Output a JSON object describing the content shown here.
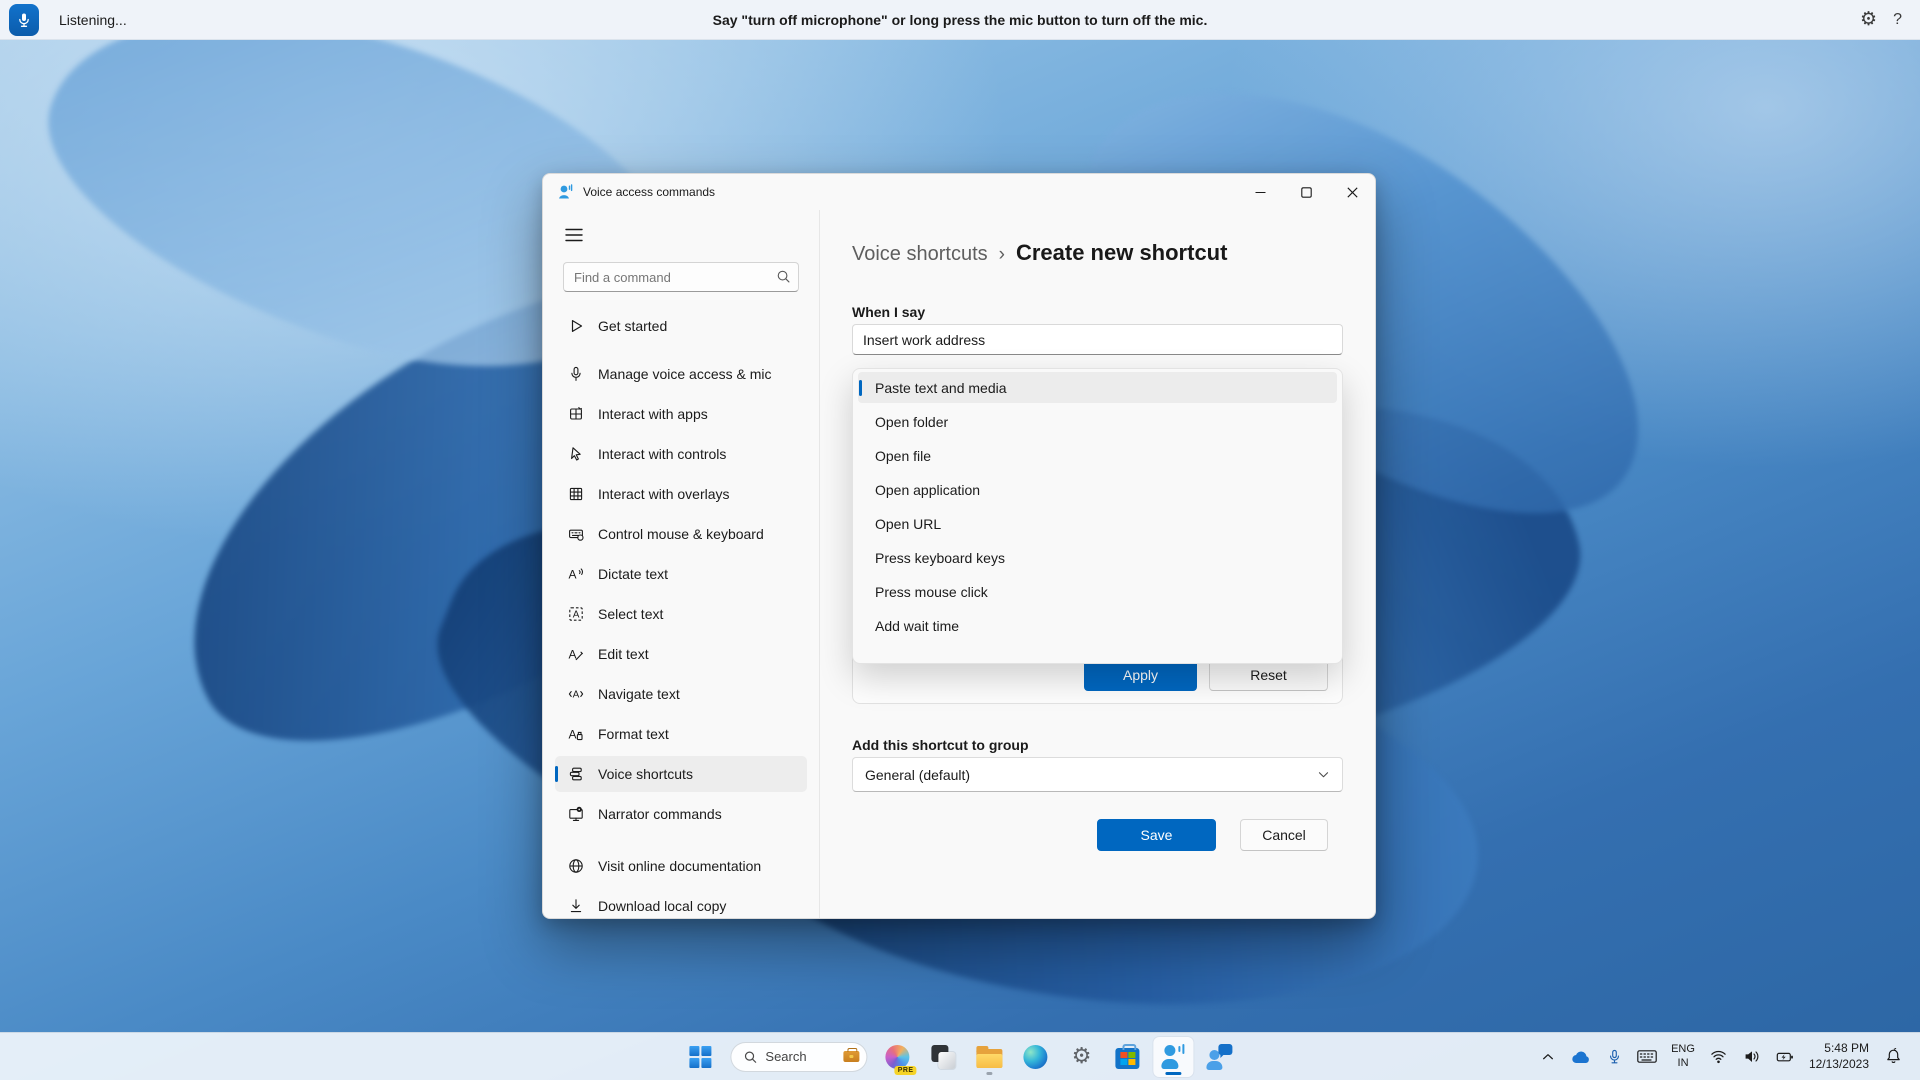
{
  "colors": {
    "accent": "#0067c0",
    "window_bg": "#f9f9f9",
    "topbar_bg": "#eff3f9",
    "taskbar_bg": "#f1f6fc",
    "selected_item_bg": "#ededed"
  },
  "voice_bar": {
    "status": "Listening...",
    "hint": "Say \"turn off microphone\" or long press the mic button to turn off the mic.",
    "help_glyph": "?",
    "gear_glyph": "⚙"
  },
  "window": {
    "title": "Voice access commands",
    "sidebar": {
      "search_placeholder": "Find a command",
      "items": [
        {
          "label": "Get started",
          "icon": "play-icon"
        },
        {
          "label": "Manage voice access & mic",
          "icon": "microphone-icon"
        },
        {
          "label": "Interact with apps",
          "icon": "app-window-icon"
        },
        {
          "label": "Interact with controls",
          "icon": "cursor-icon"
        },
        {
          "label": "Interact with overlays",
          "icon": "grid-overlay-icon"
        },
        {
          "label": "Control mouse & keyboard",
          "icon": "keyboard-mouse-icon"
        },
        {
          "label": "Dictate text",
          "icon": "dictate-text-icon"
        },
        {
          "label": "Select text",
          "icon": "select-text-icon"
        },
        {
          "label": "Edit text",
          "icon": "edit-text-icon"
        },
        {
          "label": "Navigate text",
          "icon": "navigate-text-icon"
        },
        {
          "label": "Format text",
          "icon": "format-text-icon"
        },
        {
          "label": "Voice shortcuts",
          "icon": "voice-shortcuts-icon",
          "selected": true
        },
        {
          "label": "Narrator commands",
          "icon": "narrator-icon"
        }
      ],
      "footer_items": [
        {
          "label": "Visit online documentation",
          "icon": "globe-icon"
        },
        {
          "label": "Download local copy",
          "icon": "download-icon"
        }
      ]
    },
    "content": {
      "breadcrumb_parent": "Voice shortcuts",
      "breadcrumb_separator": "›",
      "page_title": "Create new shortcut",
      "when_i_say_label": "When I say",
      "when_i_say_value": "Insert work address",
      "dropdown": {
        "highlighted": "Paste text and media",
        "options": [
          "Paste text and media",
          "Open folder",
          "Open file",
          "Open application",
          "Open URL",
          "Press keyboard keys",
          "Press mouse click",
          "Add wait time"
        ]
      },
      "apply_label": "Apply",
      "reset_label": "Reset",
      "group_label": "Add this shortcut to group",
      "group_value": "General (default)",
      "save_label": "Save",
      "cancel_label": "Cancel"
    }
  },
  "taskbar": {
    "search_label": "Search",
    "copilot_badge": "PRE",
    "tray": {
      "language_top": "ENG",
      "language_bottom": "IN",
      "time": "5:48 PM",
      "date": "12/13/2023"
    }
  }
}
